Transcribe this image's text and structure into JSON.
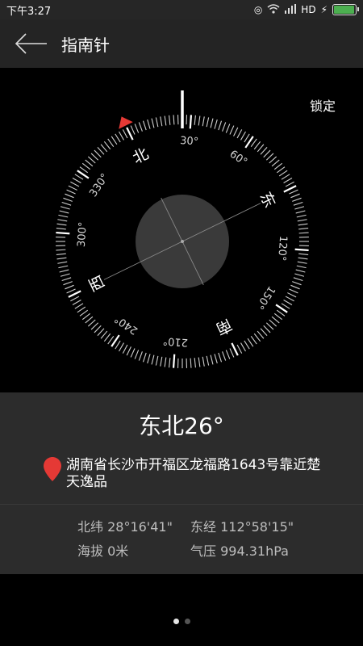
{
  "status": {
    "time": "下午3:27",
    "network": "HD",
    "icons": [
      "alarm-icon",
      "wifi-icon",
      "signal-icon",
      "charging-icon",
      "battery-icon"
    ],
    "battery_level": 0.9
  },
  "header": {
    "title": "指南针",
    "back_icon": "back-arrow-icon"
  },
  "lock_label": "锁定",
  "compass": {
    "heading": 26,
    "labels": [
      {
        "text": "北",
        "angle": 0,
        "type": "cardinal"
      },
      {
        "text": "30°",
        "angle": 30,
        "type": "degree"
      },
      {
        "text": "60°",
        "angle": 60,
        "type": "degree"
      },
      {
        "text": "东",
        "angle": 90,
        "type": "cardinal"
      },
      {
        "text": "120°",
        "angle": 120,
        "type": "degree"
      },
      {
        "text": "150°",
        "angle": 150,
        "type": "degree"
      },
      {
        "text": "南",
        "angle": 180,
        "type": "cardinal"
      },
      {
        "text": "210°",
        "angle": 210,
        "type": "degree"
      },
      {
        "text": "240°",
        "angle": 240,
        "type": "degree"
      },
      {
        "text": "西",
        "angle": 270,
        "type": "cardinal"
      },
      {
        "text": "300°",
        "angle": 300,
        "type": "degree"
      },
      {
        "text": "330°",
        "angle": 330,
        "type": "degree"
      }
    ],
    "marker_color": "#e53935"
  },
  "info": {
    "direction": "东北26°",
    "address": "湖南省长沙市开福区龙福路1643号靠近楚天逸品",
    "latitude": "北纬 28°16'41\"",
    "longitude": "东经 112°58'15\"",
    "altitude": "海拔 0米",
    "pressure": "气压 994.31hPa",
    "pin_color": "#e53935"
  },
  "pager": {
    "count": 2,
    "active": 0
  }
}
